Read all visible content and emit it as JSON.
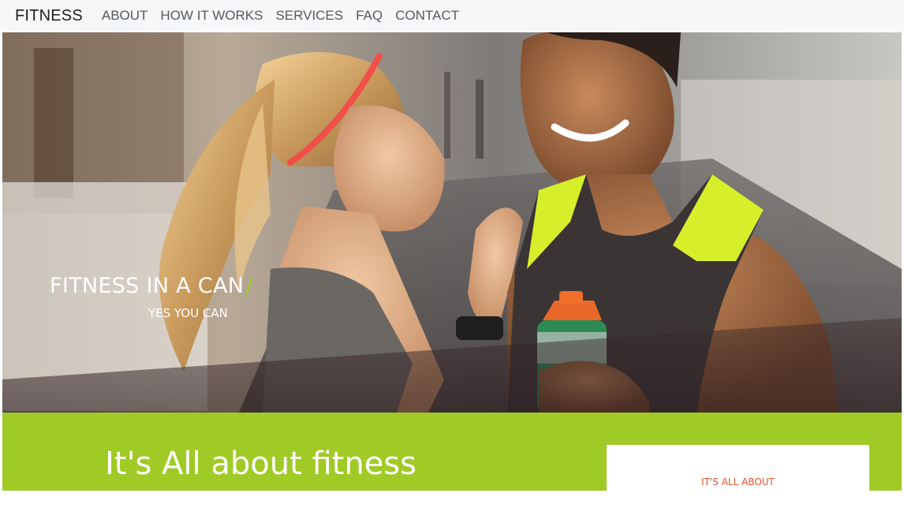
{
  "navbar": {
    "brand": "FITNESS",
    "links": [
      "ABOUT",
      "HOW IT WORKS",
      "SERVICES",
      "FAQ",
      "CONTACT"
    ]
  },
  "hero": {
    "title": "FITNESS IN A CAN",
    "title_accent": "/",
    "subtitle": "YES YOU CAN"
  },
  "section": {
    "heading": "It's All about fitness",
    "card_label": "IT'S ALL ABOUT"
  },
  "colors": {
    "accent_green": "#a0ca26",
    "card_label": "#e3522b",
    "nav_bg": "#f5f7f9"
  }
}
